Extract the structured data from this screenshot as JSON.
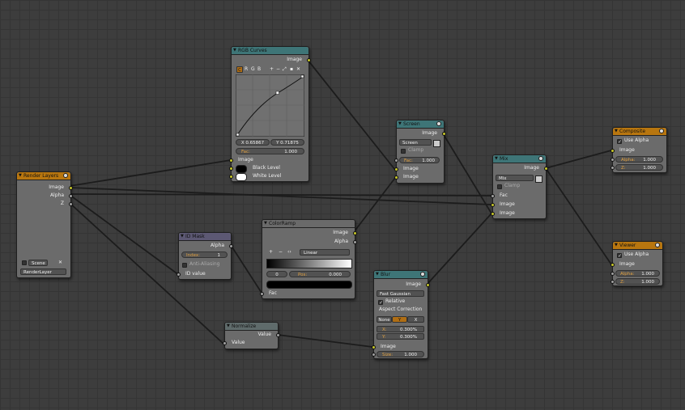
{
  "colors": {
    "grid_bg": "#3d3d3d",
    "link": "#1c1c1c",
    "socket_color": "#c7c729",
    "socket_gray": "#a1a1a1",
    "header_teal": "#3e7577",
    "header_orange": "#b8760f",
    "header_purple": "#5c5873"
  },
  "render_layers": {
    "title": "Render Layers",
    "outputs": [
      "Image",
      "Alpha",
      "Z"
    ],
    "scene_value": "Scene",
    "layer_value": "RenderLayer"
  },
  "rgb_curves": {
    "title": "RGB Curves",
    "output": "Image",
    "tabs": [
      "C",
      "R",
      "G",
      "B"
    ],
    "tools": [
      "+",
      "−",
      "⤢",
      "▪",
      "✕"
    ],
    "x_value": "X 0.65867",
    "y_value": "Y 0.71875",
    "fac_label": "Fac:",
    "fac_value": "1.000",
    "inputs": [
      "Image",
      "Black Level",
      "White Level"
    ]
  },
  "id_mask": {
    "title": "ID Mask",
    "output": "Alpha",
    "index_label": "Index:",
    "index_value": "1",
    "anti_aliasing": "Anti-Aliasing",
    "input": "ID value"
  },
  "color_ramp": {
    "title": "ColorRamp",
    "outputs": [
      "Image",
      "Alpha"
    ],
    "tools": [
      "+",
      "−",
      "‹›"
    ],
    "interp": "Linear",
    "stop_value": "0",
    "pos_label": "Pos:",
    "pos_value": "0.000",
    "input": "Fac"
  },
  "screen": {
    "title": "Screen",
    "output": "Image",
    "blend": "Screen",
    "clamp": "Clamp",
    "fac_label": "Fac:",
    "fac_value": "1.000",
    "inputs": [
      "Image",
      "Image"
    ]
  },
  "mix": {
    "title": "Mix",
    "output": "Image",
    "blend": "Mix",
    "clamp": "Clamp",
    "inputs": [
      "Fac",
      "Image",
      "Image"
    ]
  },
  "blur": {
    "title": "Blur",
    "output": "Image",
    "filter": "Fast Gaussian",
    "relative": "Relative",
    "aspect": "Aspect Correction",
    "aspect_opts": [
      "None",
      "Y",
      "X"
    ],
    "x_label": "X:",
    "x_value": "0.300%",
    "y_label": "Y:",
    "y_value": "0.300%",
    "input": "Image",
    "size_label": "Size:",
    "size_value": "1.000"
  },
  "normalize": {
    "title": "Normalize",
    "output": "Value",
    "input": "Value"
  },
  "composite": {
    "title": "Composite",
    "use_alpha": "Use Alpha",
    "inputs": [
      "Image"
    ],
    "alpha_label": "Alpha:",
    "alpha_value": "1.000",
    "z_label": "Z:",
    "z_value": "1.000"
  },
  "viewer": {
    "title": "Viewer",
    "use_alpha": "Use Alpha",
    "inputs": [
      "Image"
    ],
    "alpha_label": "Alpha:",
    "alpha_value": "1.000",
    "z_label": "Z:",
    "z_value": "1.000"
  }
}
